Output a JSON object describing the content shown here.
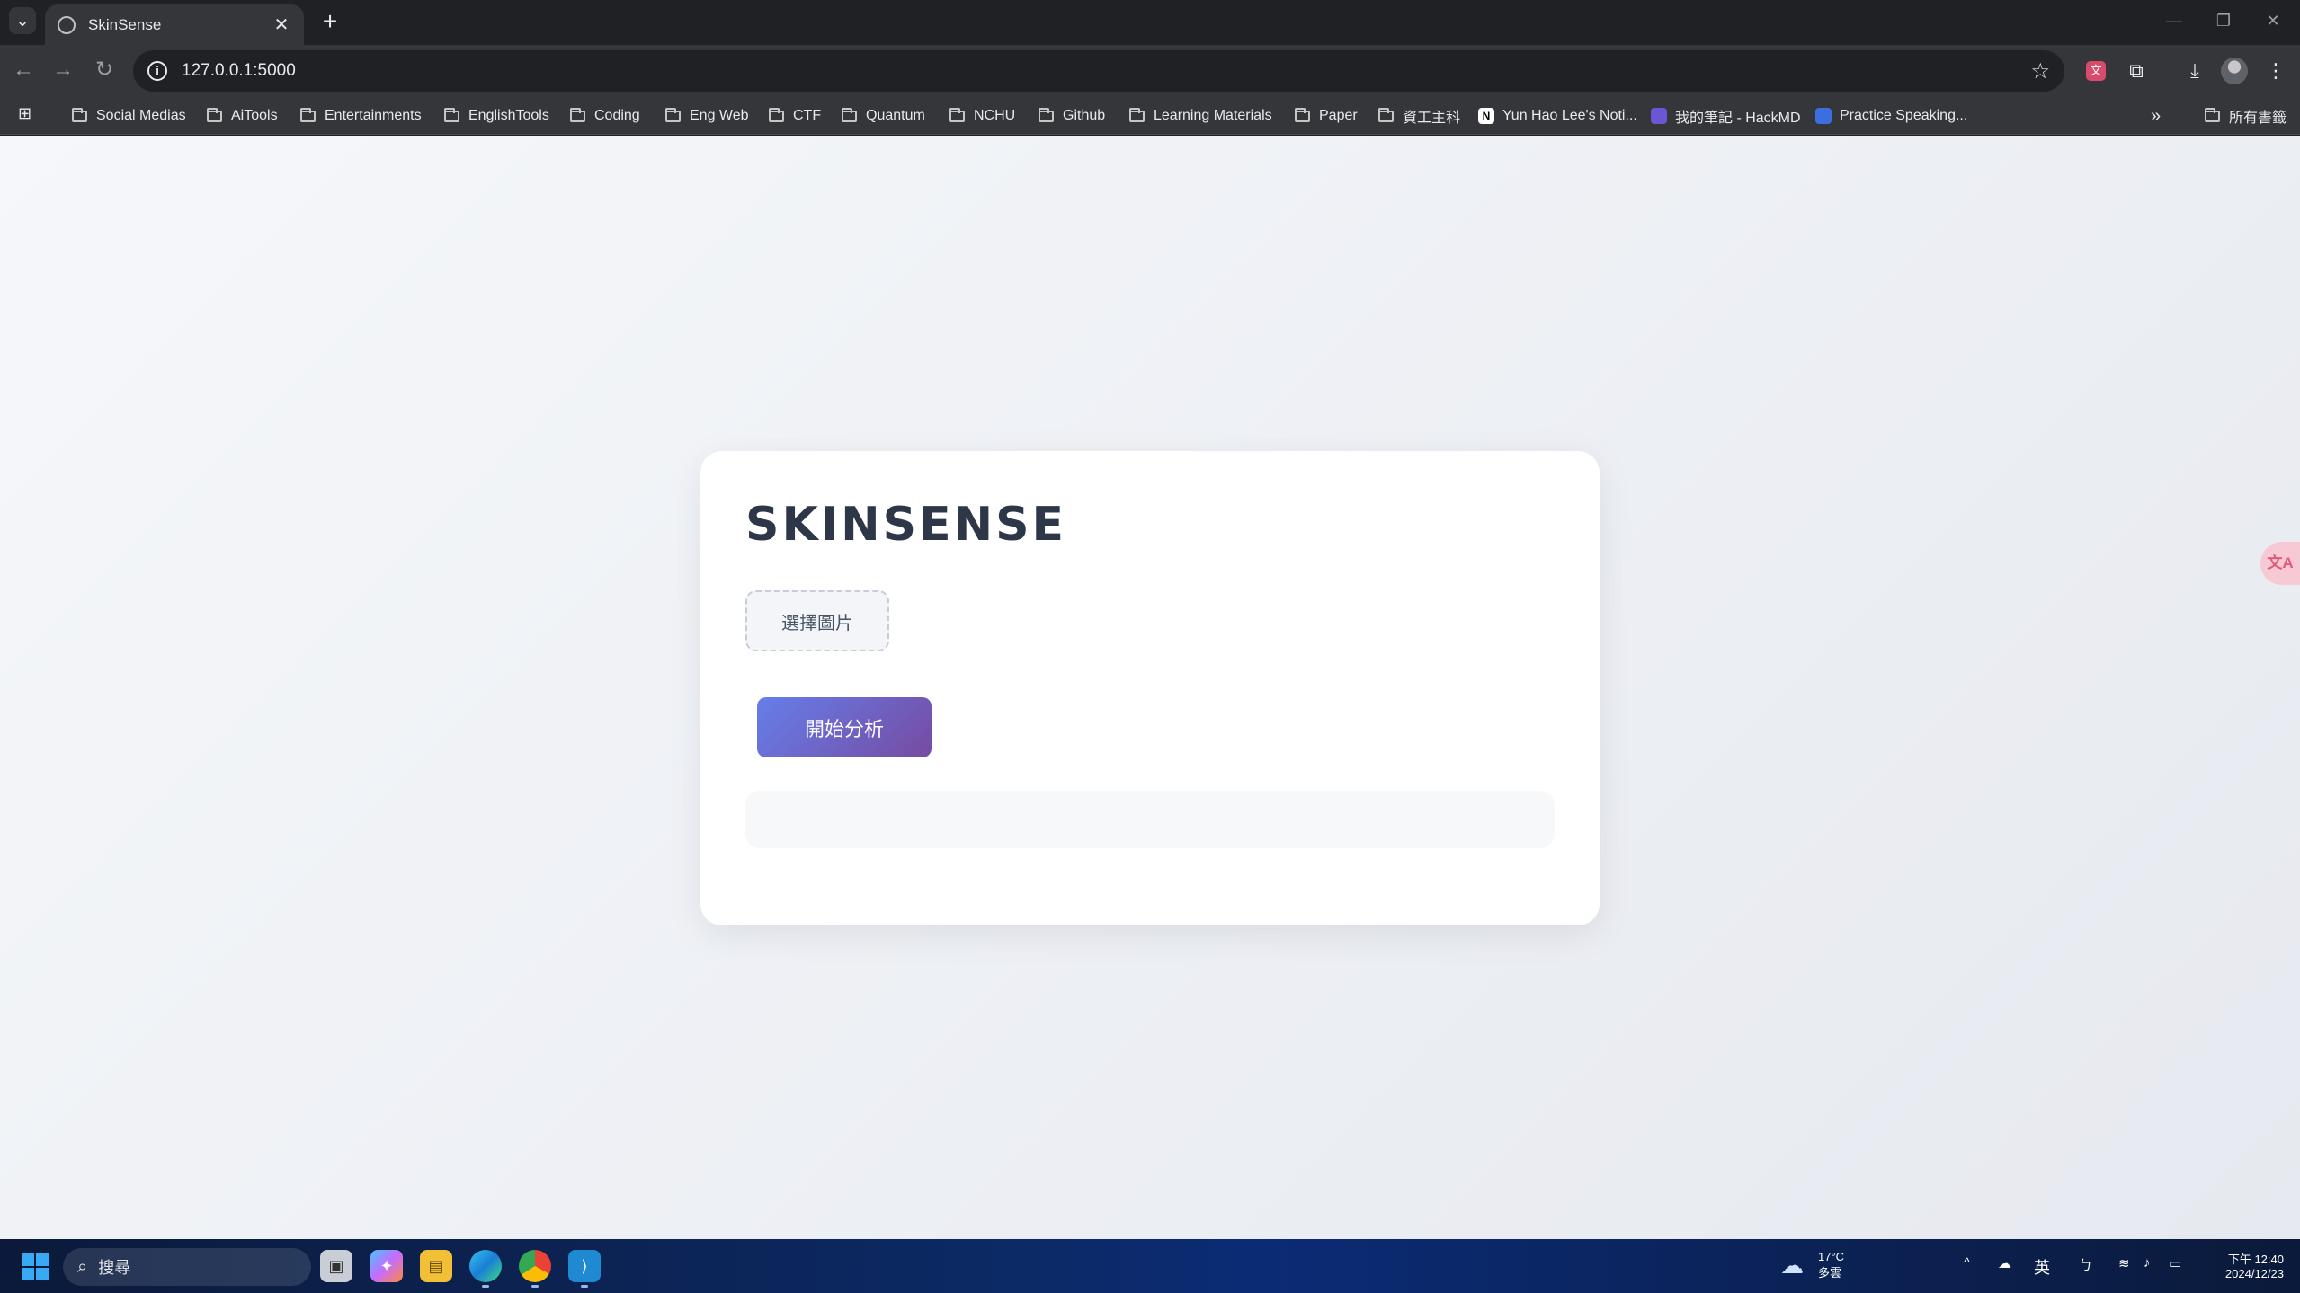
{
  "browser": {
    "tab": {
      "title": "SkinSense",
      "close": "✕"
    },
    "new_tab": "+",
    "url": "127.0.0.1:5000",
    "window_controls": {
      "minimize": "—",
      "restore": "❐",
      "close": "✕"
    }
  },
  "bookmarks": [
    {
      "label": "Social Medias",
      "type": "folder"
    },
    {
      "label": "AiTools",
      "type": "folder"
    },
    {
      "label": "Entertainments",
      "type": "folder"
    },
    {
      "label": "EnglishTools",
      "type": "folder"
    },
    {
      "label": "Coding",
      "type": "folder"
    },
    {
      "label": "Eng Web",
      "type": "folder"
    },
    {
      "label": "CTF",
      "type": "folder"
    },
    {
      "label": "Quantum",
      "type": "folder"
    },
    {
      "label": "NCHU",
      "type": "folder"
    },
    {
      "label": "Github",
      "type": "folder"
    },
    {
      "label": "Learning Materials",
      "type": "folder"
    },
    {
      "label": "Paper",
      "type": "folder"
    },
    {
      "label": "資工主科",
      "type": "folder"
    },
    {
      "label": "Yun Hao Lee's Noti...",
      "type": "page"
    },
    {
      "label": "我的筆記 - HackMD",
      "type": "page"
    },
    {
      "label": "Practice Speaking...",
      "type": "page"
    }
  ],
  "bookmarks_overflow": "»",
  "all_bookmarks": "所有書籤",
  "app": {
    "brand": "SKINSENSE",
    "choose_image": "選擇圖片",
    "analyze": "開始分析",
    "result": ""
  },
  "taskbar": {
    "search_placeholder": "搜尋",
    "weather_temp": "17°C",
    "weather_desc": "多雲",
    "ime": "英",
    "time": "下午 12:40",
    "date": "2024/12/23"
  },
  "colors": {
    "accent_start": "#667eea",
    "accent_end": "#764ba2",
    "brand_text": "#2d3748"
  }
}
